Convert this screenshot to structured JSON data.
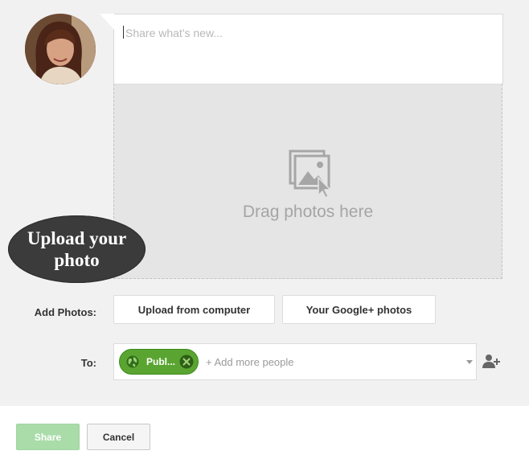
{
  "composer": {
    "placeholder": "Share what's new..."
  },
  "dropzone": {
    "text": "Drag photos here",
    "icon": "photo-drag-icon"
  },
  "overlay": {
    "text": "Upload your photo"
  },
  "photos": {
    "label": "Add Photos:",
    "upload_button": "Upload from computer",
    "google_button": "Your Google+ photos"
  },
  "recipients": {
    "label": "To:",
    "chip_label": "Publ...",
    "chip_icon": "globe-icon",
    "add_placeholder": "+ Add more people",
    "add_icon": "person-add-icon"
  },
  "actions": {
    "share_label": "Share",
    "cancel_label": "Cancel"
  },
  "colors": {
    "chip_green": "#5aa531",
    "share_disabled": "#a9dca9",
    "panel_bg": "#f1f1f1",
    "dropzone_bg": "#e5e5e5"
  }
}
